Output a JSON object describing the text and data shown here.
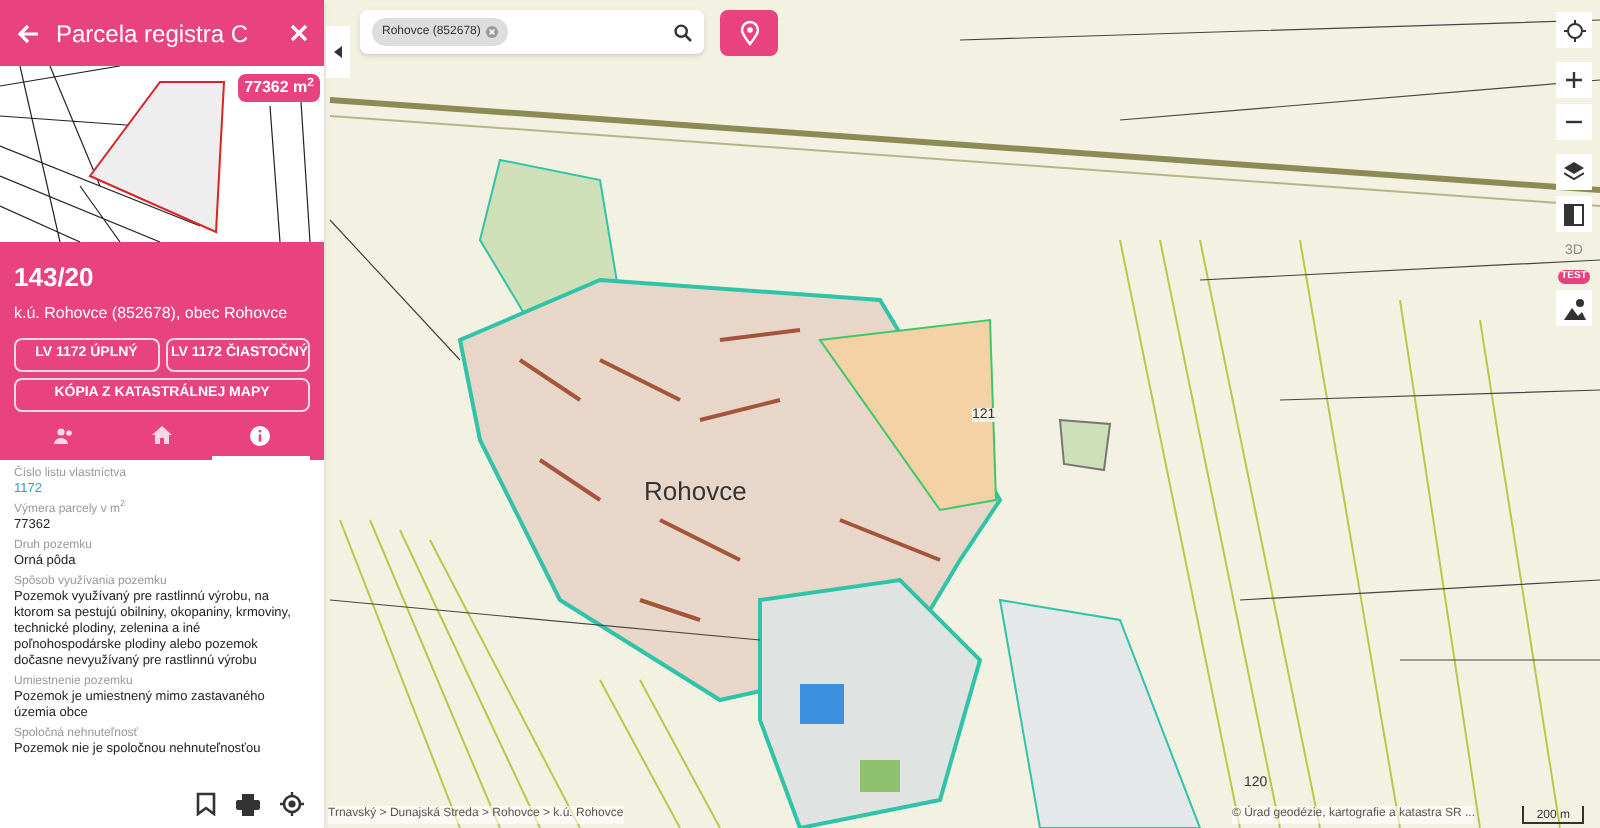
{
  "panel": {
    "title": "Parcela registra C",
    "area_badge": "77362 m$^{2}$",
    "parcel_number": "143/20",
    "parcel_location": "k.ú. Rohovce (852678), obec Rohovce",
    "buttons": [
      "LV 1172 ÚPLNÝ",
      "LV 1172 ČIASTOČNÝ",
      "KÓPIA Z KATASTRÁLNEJ MAPY"
    ],
    "tabs": [
      {
        "kind": "owners",
        "selected": false
      },
      {
        "kind": "home",
        "selected": false
      },
      {
        "kind": "info",
        "selected": true
      }
    ],
    "fields": [
      {
        "label": "Číslo listu vlastníctva",
        "value": "1172",
        "link": true
      },
      {
        "label": "Výmera parcely v m$^{2}$",
        "value": "77362",
        "link": false
      },
      {
        "label": "Druh pozemku",
        "value": "Orná pôda",
        "link": false
      },
      {
        "label": "Spôsob využívania pozemku",
        "value": "Pozemok využívaný pre rastlinnú výrobu, na ktorom sa pestujú obilniny, okopaniny, krmoviny, technické plodiny, zelenina a iné poľnohospodárske plodiny alebo pozemok dočasne nevyužívaný pre rastlinnú výrobu",
        "link": false
      },
      {
        "label": "Umiestnenie pozemku",
        "value": "Pozemok je umiestnený mimo zastavaného územia obce",
        "link": false
      },
      {
        "label": "Spoločná nehnuteľnosť",
        "value": "Pozemok nie je spoločnou nehnuteľnosťou",
        "link": false
      }
    ]
  },
  "search": {
    "chip": "Rohovce (852678)"
  },
  "map": {
    "labels": [
      {
        "text": "Rohovce",
        "kind": "town"
      },
      {
        "text": "121",
        "kind": "contour"
      },
      {
        "text": "120",
        "kind": "contour"
      }
    ],
    "scale": "200 m",
    "tt_badge": "3D",
    "test_badge": "TEST",
    "breadcrumb": "Trnavský > Dunajská Streda > Rohovce > k.ú. Rohovce",
    "attribution": "© Úrad geodézie, kartografie a katastra SR ..."
  }
}
